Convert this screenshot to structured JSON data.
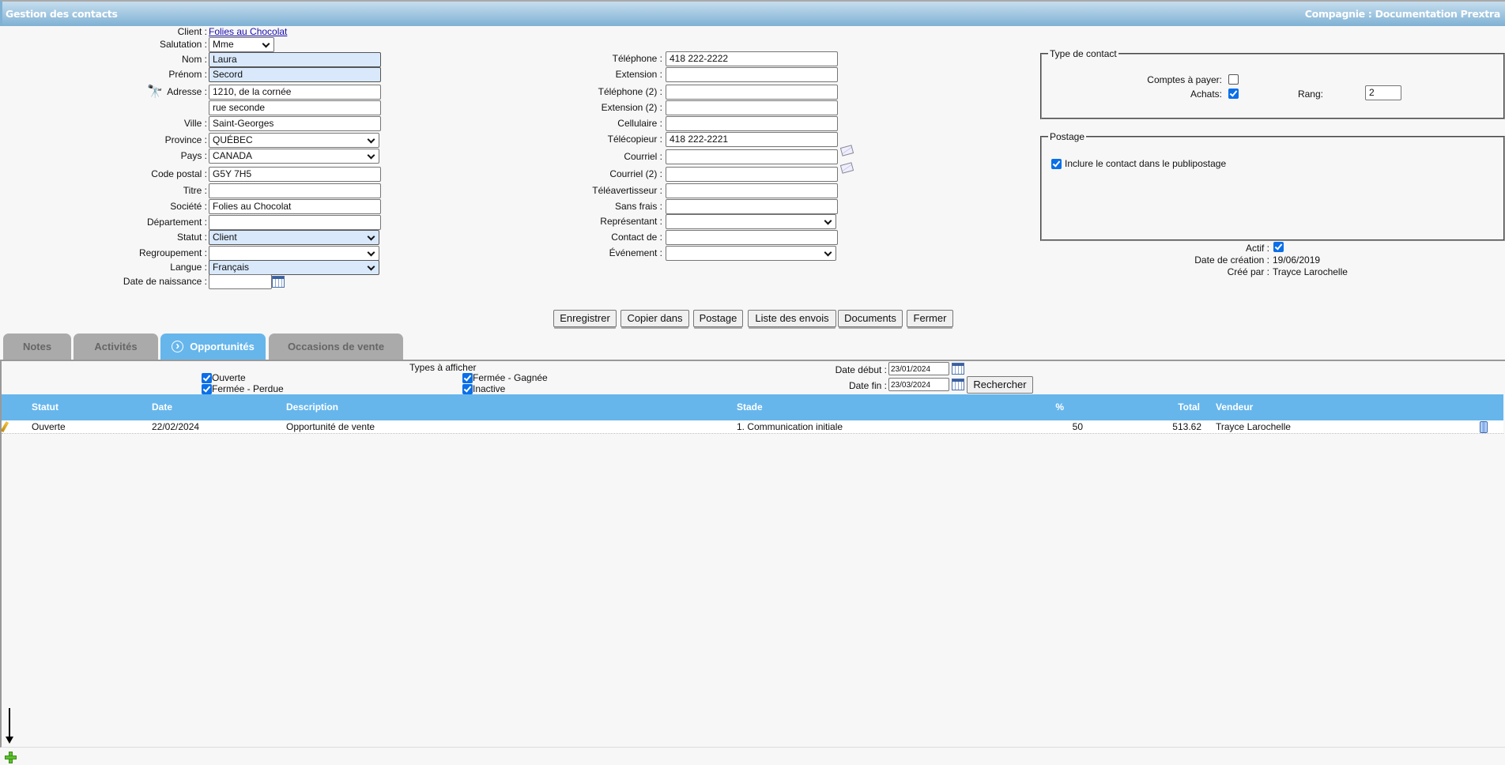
{
  "header": {
    "title": "Gestion des contacts",
    "company": "Compagnie : Documentation Prextra"
  },
  "client": {
    "label": "Client :",
    "value": "Folies au Chocolat"
  },
  "left_fields": [
    {
      "label": "Salutation :",
      "value": "Mme",
      "type": "select"
    },
    {
      "label": "Nom :",
      "value": "Laura",
      "type": "input",
      "highlight": true
    },
    {
      "label": "Prénom :",
      "value": "Secord",
      "type": "input",
      "highlight": true
    },
    {
      "label": "Adresse :",
      "value": "1210, de la cornée",
      "type": "input"
    },
    {
      "label": "",
      "value": "rue seconde",
      "type": "input"
    },
    {
      "label": "Ville :",
      "value": "Saint-Georges",
      "type": "input"
    },
    {
      "label": "Province :",
      "value": "QUÉBEC",
      "type": "select"
    },
    {
      "label": "Pays :",
      "value": "CANADA",
      "type": "select"
    },
    {
      "label": "Code postal :",
      "value": "G5Y 7H5",
      "type": "input"
    },
    {
      "label": "Titre :",
      "value": "",
      "type": "input"
    },
    {
      "label": "Société :",
      "value": "Folies au Chocolat",
      "type": "input"
    },
    {
      "label": "Département :",
      "value": "",
      "type": "input"
    },
    {
      "label": "Statut :",
      "value": "Client",
      "type": "select",
      "highlight": true
    },
    {
      "label": "Regroupement :",
      "value": "",
      "type": "select"
    },
    {
      "label": "Langue :",
      "value": "Français",
      "type": "select",
      "highlight": true
    },
    {
      "label": "Date de naissance :",
      "value": "",
      "type": "date"
    }
  ],
  "middle_fields": [
    {
      "label": "Téléphone :",
      "value": "418 222-2222",
      "type": "input"
    },
    {
      "label": "Extension :",
      "value": "",
      "type": "input"
    },
    {
      "label": "Téléphone (2) :",
      "value": "",
      "type": "input"
    },
    {
      "label": "Extension (2) :",
      "value": "",
      "type": "input"
    },
    {
      "label": "Cellulaire :",
      "value": "",
      "type": "input"
    },
    {
      "label": "Télécopieur :",
      "value": "418 222-2221",
      "type": "input"
    },
    {
      "label": "Courriel :",
      "value": "",
      "type": "email"
    },
    {
      "label": "Courriel (2) :",
      "value": "",
      "type": "email"
    },
    {
      "label": "Téléavertisseur :",
      "value": "",
      "type": "input"
    },
    {
      "label": "Sans frais :",
      "value": "",
      "type": "input"
    },
    {
      "label": "Représentant :",
      "value": "",
      "type": "select"
    },
    {
      "label": "Contact de :",
      "value": "",
      "type": "input"
    },
    {
      "label": "Événement :",
      "value": "",
      "type": "select"
    }
  ],
  "type_contact": {
    "legend": "Type de contact",
    "comptes_label": "Comptes à payer:",
    "comptes_checked": false,
    "achats_label": "Achats:",
    "achats_checked": true,
    "rang_label": "Rang:",
    "rang_value": "2"
  },
  "postage": {
    "legend": "Postage",
    "include_label": "Inclure le contact dans le publipostage",
    "include_checked": true
  },
  "meta": {
    "actif_label": "Actif :",
    "actif_checked": true,
    "date_creation_label": "Date de création :",
    "date_creation": "19/06/2019",
    "cree_par_label": "Créé par :",
    "cree_par": "Trayce Larochelle"
  },
  "buttons": [
    "Enregistrer",
    "Copier dans",
    "Postage",
    "Liste des envois",
    "Documents",
    "Fermer"
  ],
  "tabs": [
    {
      "label": "Notes",
      "active": false
    },
    {
      "label": "Activités",
      "active": false
    },
    {
      "label": "Opportunités",
      "active": true
    },
    {
      "label": "Occasions de vente",
      "active": false
    }
  ],
  "filters": {
    "types_label": "Types à afficher",
    "types": [
      {
        "label": "Ouverte",
        "checked": true
      },
      {
        "label": "Fermée - Gagnée",
        "checked": true
      },
      {
        "label": "Fermée - Perdue",
        "checked": true
      },
      {
        "label": "Inactive",
        "checked": true
      }
    ],
    "date_debut_label": "Date début :",
    "date_debut": "23/01/2024",
    "date_fin_label": "Date fin :",
    "date_fin": "23/03/2024",
    "search_label": "Rechercher"
  },
  "table": {
    "columns": [
      "Statut",
      "Date",
      "Description",
      "Stade",
      "%",
      "Total",
      "Vendeur"
    ],
    "rows": [
      [
        "Ouverte",
        "22/02/2024",
        "Opportunité de vente",
        "1. Communication initiale",
        "50",
        "513.62",
        "Trayce Larochelle"
      ]
    ]
  },
  "colors": {
    "accent": "#66b6ec",
    "header_gradient_top": "#c6deee",
    "header_gradient_bottom": "#7fb1d4",
    "highlight_input": "#d9e9fb"
  }
}
